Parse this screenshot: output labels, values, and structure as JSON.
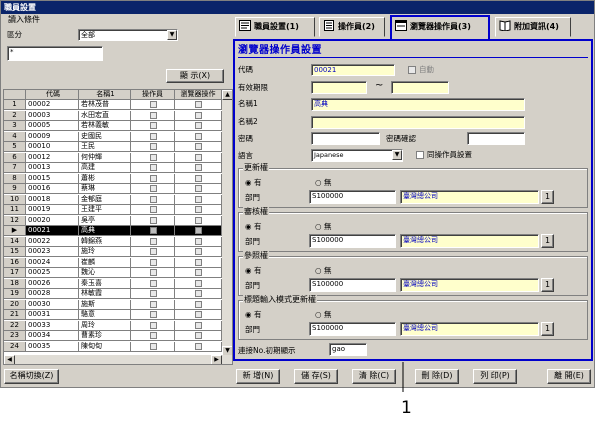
{
  "window": {
    "title": "職員設置"
  },
  "query": {
    "label": "讀入條件",
    "region_label": "區分",
    "region_value": "全部",
    "filter_value": "*",
    "display_button": "顯 示(X)"
  },
  "grid": {
    "headers": [
      "代碼",
      "名稱1",
      "操作員",
      "瀏覽器操作"
    ],
    "rows": [
      {
        "n": "1",
        "code": "00002",
        "name": "若林茂普",
        "op": false,
        "br": false
      },
      {
        "n": "2",
        "code": "00003",
        "name": "水田宏直",
        "op": false,
        "br": false
      },
      {
        "n": "3",
        "code": "00005",
        "name": "若林義敏",
        "op": false,
        "br": false
      },
      {
        "n": "4",
        "code": "00009",
        "name": "史國民",
        "op": false,
        "br": false
      },
      {
        "n": "5",
        "code": "00010",
        "name": "王民",
        "op": false,
        "br": false
      },
      {
        "n": "6",
        "code": "00012",
        "name": "何仲輝",
        "op": false,
        "br": false
      },
      {
        "n": "7",
        "code": "00013",
        "name": "高建",
        "op": false,
        "br": false
      },
      {
        "n": "8",
        "code": "00015",
        "name": "蕭彬",
        "op": false,
        "br": false
      },
      {
        "n": "9",
        "code": "00016",
        "name": "蔡琳",
        "op": false,
        "br": false
      },
      {
        "n": "10",
        "code": "00018",
        "name": "金郁庭",
        "op": false,
        "br": false
      },
      {
        "n": "11",
        "code": "00019",
        "name": "王建平",
        "op": false,
        "br": false
      },
      {
        "n": "12",
        "code": "00020",
        "name": "吳亭",
        "op": false,
        "br": false
      },
      {
        "n": "",
        "code": "00021",
        "name": "高典",
        "op": true,
        "br": true
      },
      {
        "n": "14",
        "code": "00022",
        "name": "韓錦燕",
        "op": false,
        "br": false
      },
      {
        "n": "15",
        "code": "00023",
        "name": "施玲",
        "op": false,
        "br": false
      },
      {
        "n": "16",
        "code": "00024",
        "name": "崔麟",
        "op": false,
        "br": false
      },
      {
        "n": "17",
        "code": "00025",
        "name": "魏沁",
        "op": false,
        "br": false
      },
      {
        "n": "18",
        "code": "00026",
        "name": "秦玉喜",
        "op": false,
        "br": false
      },
      {
        "n": "19",
        "code": "00028",
        "name": "林敏霞",
        "op": false,
        "br": false
      },
      {
        "n": "20",
        "code": "00030",
        "name": "施斯",
        "op": false,
        "br": false
      },
      {
        "n": "21",
        "code": "00031",
        "name": "駱意",
        "op": false,
        "br": false
      },
      {
        "n": "22",
        "code": "00033",
        "name": "周玲",
        "op": false,
        "br": false
      },
      {
        "n": "23",
        "code": "00034",
        "name": "曹素珍",
        "op": false,
        "br": false
      },
      {
        "n": "24",
        "code": "00035",
        "name": "陳旬旬",
        "op": false,
        "br": false
      }
    ],
    "selected_index": 12
  },
  "tabs": [
    {
      "label": "職員設置(1)",
      "active": false
    },
    {
      "label": "操作員(2)",
      "active": false
    },
    {
      "label": "瀏覽器操作員(3)",
      "active": true
    },
    {
      "label": "附加資訊(4)",
      "active": false
    }
  ],
  "form": {
    "title": "瀏覽器操作員設置",
    "code_label": "代碼",
    "code_value": "00021",
    "auto_label": "自動",
    "validity_label": "有效期限",
    "tilde": "~",
    "name1_label": "名稱1",
    "name1_value": "高典",
    "name2_label": "名稱2",
    "password_label": "密碼",
    "password_confirm_label": "密碼確認",
    "language_label": "語言",
    "language_value": "Japanese",
    "same_as_operator_label": "同操作員設置",
    "groups": [
      {
        "title": "更新權",
        "yes": "有",
        "no": "無",
        "dept_label": "部門",
        "dept_code": "S100000",
        "dept_name": "臺灣總公司",
        "btn": "1"
      },
      {
        "title": "審核權",
        "yes": "有",
        "no": "無",
        "dept_label": "部門",
        "dept_code": "S100000",
        "dept_name": "臺灣總公司",
        "btn": "1"
      },
      {
        "title": "參照權",
        "yes": "有",
        "no": "無",
        "dept_label": "部門",
        "dept_code": "S100000",
        "dept_name": "臺灣總公司",
        "btn": "1"
      },
      {
        "title": "標題輸入模式更新權",
        "yes": "有",
        "no": "無",
        "dept_label": "部門",
        "dept_code": "S100000",
        "dept_name": "臺灣總公司",
        "btn": "1"
      }
    ],
    "initial_display_label": "連接No.初期顯示",
    "initial_display_value": "gao"
  },
  "bottom": {
    "name_switch": "名稱切換(Z)",
    "new": "新 增(N)",
    "save": "儲 存(S)",
    "clear": "清 除(C)",
    "delete": "刪 除(D)",
    "print": "列 印(P)",
    "close": "離 開(E)"
  },
  "callout": "1",
  "colors": {
    "accent": "#0000cc",
    "title_bar": "#0a246a",
    "field_yellow": "#ffffcc"
  }
}
